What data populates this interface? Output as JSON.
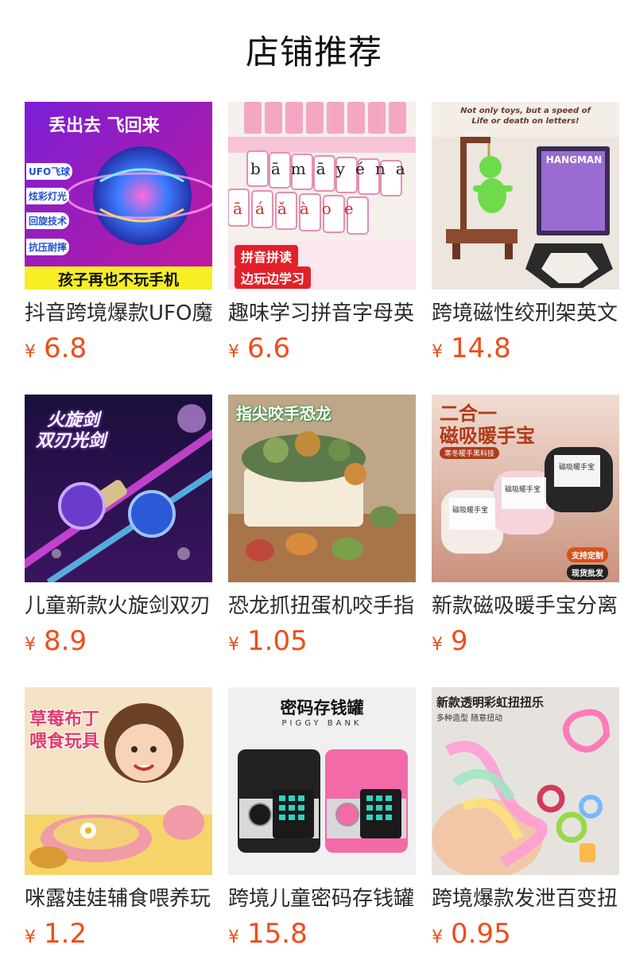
{
  "shop": {
    "title": "店铺推荐"
  },
  "currency_symbol": "¥",
  "colors": {
    "price": "#ee4d1a",
    "text": "#2b2b2b"
  },
  "products": [
    {
      "name": "抖音跨境爆款UFO魔",
      "price": "6.8",
      "image": {
        "headline": "丢出去 飞回来",
        "tags": [
          "UFO飞球",
          "炫彩灯光",
          "回旋技术",
          "抗压耐摔"
        ],
        "banner": "孩子再也不玩手机"
      }
    },
    {
      "name": "趣味学习拼音字母英",
      "price": "6.6",
      "image": {
        "tiles_row1": [
          "b",
          "ā",
          "m",
          "ā",
          "y",
          "é",
          "n",
          "ai"
        ],
        "tiles_row2": [
          "ā",
          "á",
          "ǎ",
          "à",
          "o",
          "e"
        ],
        "tags": [
          "拼音拼读",
          "边玩边学习"
        ]
      }
    },
    {
      "name": "跨境磁性绞刑架英文",
      "price": "14.8",
      "image": {
        "headline_1": "Not only toys, but a speed of",
        "headline_2": "Life or death on letters!",
        "box_title": "HANGMAN"
      }
    },
    {
      "name": "儿童新款火旋剑双刃",
      "price": "8.9",
      "image": {
        "headline_1": "火旋剑",
        "headline_2": "双刃光剑"
      }
    },
    {
      "name": "恐龙抓扭蛋机咬手指",
      "price": "1.05",
      "image": {
        "headline": "指尖咬手恐龙"
      }
    },
    {
      "name": "新款磁吸暖手宝分离",
      "price": "9",
      "image": {
        "headline_1": "二合一",
        "headline_2": "磁吸暖手宝",
        "subtitle": "寒冬暖手黑科技",
        "card_text": "磁吸暖手宝",
        "badge_1": "支持定制",
        "badge_2": "现货批发"
      }
    },
    {
      "name": "咪露娃娃辅食喂养玩",
      "price": "1.2",
      "image": {
        "headline_1": "草莓布丁",
        "headline_2": "喂食玩具"
      }
    },
    {
      "name": "跨境儿童密码存钱罐",
      "price": "15.8",
      "image": {
        "headline": "密码存钱罐",
        "subtitle": "PIGGY BANK"
      }
    },
    {
      "name": "跨境爆款发泄百变扭",
      "price": "0.95",
      "image": {
        "headline": "新款透明彩虹扭扭乐",
        "subtitle": "多种造型 随意扭动"
      }
    }
  ]
}
